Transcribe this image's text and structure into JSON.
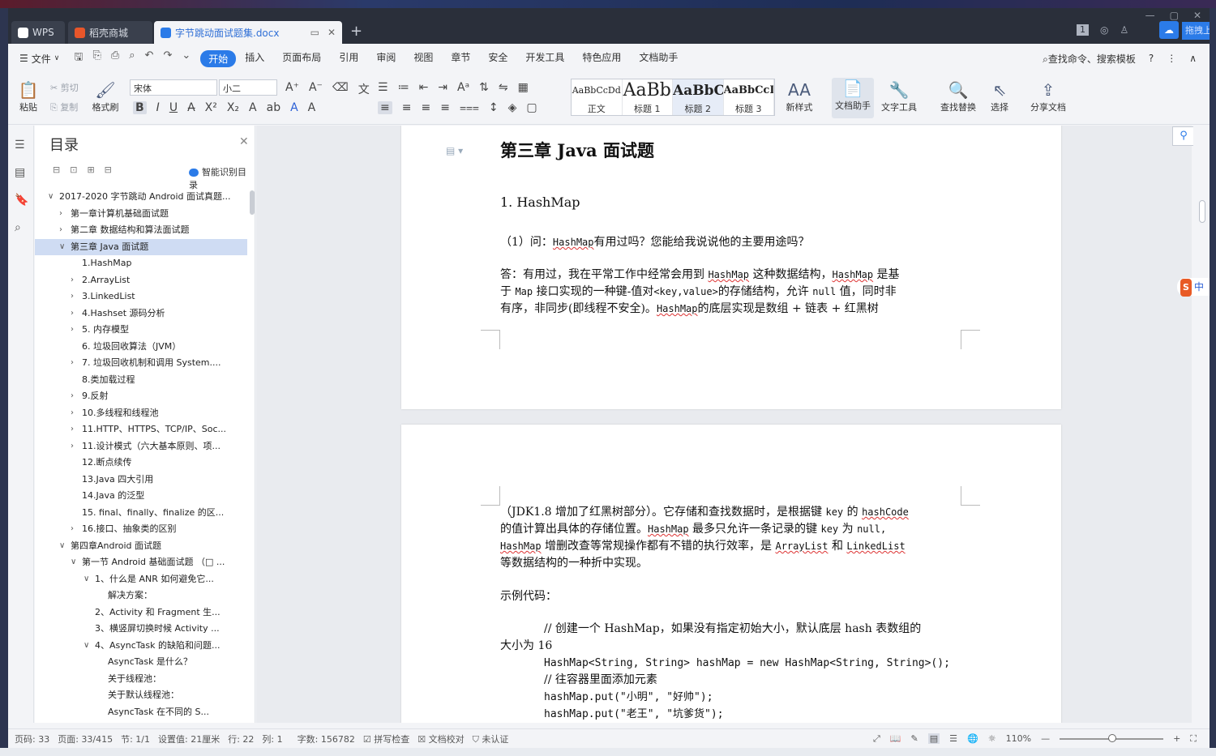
{
  "titlebar": {
    "tabs": [
      {
        "label": "WPS"
      },
      {
        "label": "稻壳商城"
      },
      {
        "label": "字节跳动面试题集.docx"
      }
    ],
    "add_tab": "+",
    "page_badge": "1",
    "cloud_label": "拖拽上"
  },
  "menubar": {
    "file": "文件",
    "items": [
      "开始",
      "插入",
      "页面布局",
      "引用",
      "审阅",
      "视图",
      "章节",
      "安全",
      "开发工具",
      "特色应用",
      "文档助手"
    ],
    "search": "查找命令、搜索模板",
    "help": "?"
  },
  "ribbon": {
    "paste": "粘贴",
    "cut": "剪切",
    "copy": "复制",
    "format_painter": "格式刷",
    "font": "宋体",
    "size": "小二",
    "styles": [
      {
        "sample": "AaBbCcDd",
        "name": "正文"
      },
      {
        "sample": "AaBb",
        "name": "标题 1"
      },
      {
        "sample": "AaBbC",
        "name": "标题 2"
      },
      {
        "sample": "AaBbCcI",
        "name": "标题 3"
      }
    ],
    "new_style": "新样式",
    "doc_helper": "文档助手",
    "text_tools": "文字工具",
    "find_replace": "查找替换",
    "select": "选择",
    "share": "分享文档"
  },
  "toc": {
    "title": "目录",
    "smart": "智能识别目录",
    "items": [
      {
        "level": 0,
        "arrow": "v",
        "label": "2017-2020 字节跳动 Android 面试真题..."
      },
      {
        "level": 1,
        "arrow": ">",
        "label": "第一章计算机基础面试题"
      },
      {
        "level": 1,
        "arrow": ">",
        "label": "第二章 数据结构和算法面试题"
      },
      {
        "level": 1,
        "arrow": "v",
        "label": "第三章 Java 面试题",
        "selected": true
      },
      {
        "level": 2,
        "arrow": "",
        "label": "1.HashMap"
      },
      {
        "level": 2,
        "arrow": ">",
        "label": "2.ArrayList"
      },
      {
        "level": 2,
        "arrow": ">",
        "label": "3.LinkedList"
      },
      {
        "level": 2,
        "arrow": ">",
        "label": "4.Hashset 源码分析"
      },
      {
        "level": 2,
        "arrow": ">",
        "label": "5. 内存模型"
      },
      {
        "level": 2,
        "arrow": "",
        "label": "6. 垃圾回收算法（JVM）"
      },
      {
        "level": 2,
        "arrow": ">",
        "label": "7. 垃圾回收机制和调用 System...."
      },
      {
        "level": 2,
        "arrow": "",
        "label": "8.类加载过程"
      },
      {
        "level": 2,
        "arrow": ">",
        "label": "9.反射"
      },
      {
        "level": 2,
        "arrow": ">",
        "label": "10.多线程和线程池"
      },
      {
        "level": 2,
        "arrow": ">",
        "label": "11.HTTP、HTTPS、TCP/IP、Soc..."
      },
      {
        "level": 2,
        "arrow": ">",
        "label": "11.设计模式（六大基本原则、项..."
      },
      {
        "level": 2,
        "arrow": "",
        "label": "12.断点续传"
      },
      {
        "level": 2,
        "arrow": "",
        "label": "13.Java 四大引用"
      },
      {
        "level": 2,
        "arrow": "",
        "label": "14.Java 的泛型"
      },
      {
        "level": 2,
        "arrow": "",
        "label": "15. final、finally、finalize 的区..."
      },
      {
        "level": 2,
        "arrow": ">",
        "label": "16.接口、抽象类的区别"
      },
      {
        "level": 1,
        "arrow": "v",
        "label": "第四章Android 面试题"
      },
      {
        "level": 2,
        "arrow": "v",
        "label": "第一节 Android 基础面试题 （□ ..."
      },
      {
        "level": 3,
        "arrow": "v",
        "label": "1、什么是 ANR 如何避免它..."
      },
      {
        "level": 4,
        "arrow": "",
        "label": "解决方案："
      },
      {
        "level": 3,
        "arrow": "",
        "label": "2、Activity 和 Fragment 生..."
      },
      {
        "level": 3,
        "arrow": "",
        "label": "3、横竖屏切换时候 Activity ..."
      },
      {
        "level": 3,
        "arrow": "v",
        "label": "4、AsyncTask 的缺陷和问题..."
      },
      {
        "level": 4,
        "arrow": "",
        "label": "AsyncTask 是什么？"
      },
      {
        "level": 4,
        "arrow": "",
        "label": "关于线程池："
      },
      {
        "level": 4,
        "arrow": "",
        "label": "关于默认线程池："
      },
      {
        "level": 4,
        "arrow": "",
        "label": "AsyncTask 在不同的 S..."
      }
    ]
  },
  "doc": {
    "chapter": "第三章 Java 面试题",
    "section": "1. HashMap",
    "question_prefix": "（1）问：",
    "question_code": "HashMap",
    "question_rest": "有用过吗？您能给我说说他的主要用途吗？",
    "answer_line1_a": "答：有用过，我在平常工作中经常会用到",
    "answer_code1": "HashMap",
    "answer_line1_b": "这种数据结构，",
    "answer_code2": "HashMap",
    "answer_line1_c": "是基",
    "answer_line2_a": "于",
    "answer_code3": "Map",
    "answer_line2_b": "接口实现的一种键-值对",
    "answer_code4": "<key,value>",
    "answer_line2_c": "的存储结构，允许",
    "answer_code5": "null",
    "answer_line2_d": "值，同时非",
    "answer_line3_a": "有序，非同步(即线程不安全)。",
    "answer_code6": "HashMap",
    "answer_line3_b": "的底层实现是数组 + 链表 + 红黑树",
    "p2_line1_a": "（JDK1.8 增加了红黑树部分）。它存储和查找数据时，是根据键",
    "p2_code1": "key",
    "p2_line1_b": "的",
    "p2_code2": "hashCode",
    "p2_line2_a": "的值计算出具体的存储位置。",
    "p2_code3": "HashMap",
    "p2_line2_b": "最多只允许一条记录的键",
    "p2_code4": "key",
    "p2_line2_c": "为",
    "p2_code5": "null,",
    "p2_code6": "HashMap",
    "p2_line3_a": "增删改查等常规操作都有不错的执行效率，是",
    "p2_code7": "ArrayList",
    "p2_line3_b": "和",
    "p2_code8": "LinkedList",
    "p2_line4": "等数据结构的一种折中实现。",
    "example_label": "示例代码：",
    "code_comment1_a": "// 创建一个 HashMap，如果没有指定初始大小，默认底层 hash 表数组的",
    "code_comment1_b": "大小为 16",
    "code_line1": "HashMap<String, String> hashMap = new HashMap<String, String>();",
    "code_comment2": "// 往容器里面添加元素",
    "code_line2": "hashMap.put(\"小明\", \"好帅\");",
    "code_line3": "hashMap.put(\"老王\", \"坑爹货\");"
  },
  "status": {
    "page_no": "页码: 33",
    "pages": "页面: 33/415",
    "section": "节: 1/1",
    "setting": "设置值: 21厘米",
    "row": "行: 22",
    "col": "列: 1",
    "words": "字数: 156782",
    "spell": "拼写检查",
    "proof": "文档校对",
    "cert": "未认证",
    "zoom": "110%"
  },
  "ime": "中"
}
